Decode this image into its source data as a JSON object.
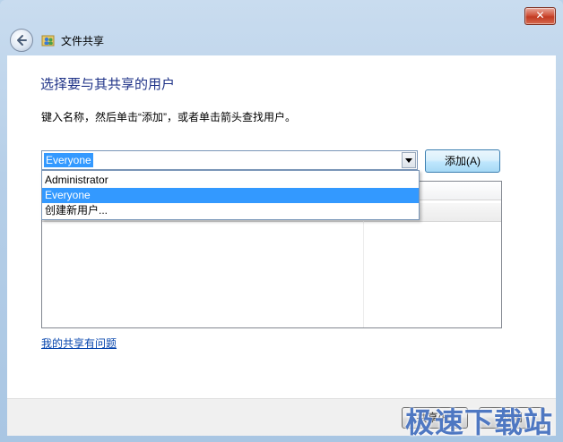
{
  "window": {
    "title": "文件共享",
    "close_label": "✕"
  },
  "main": {
    "heading": "选择要与其共享的用户",
    "instruction": "键入名称，然后单击“添加”，或者单击箭头查找用户。",
    "combo_value": "Everyone",
    "add_button": "添加(A)",
    "dropdown_options": [
      "Administrator",
      "Everyone",
      "创建新用户..."
    ],
    "dropdown_selected": "Everyone",
    "help_link": "我的共享有问题"
  },
  "footer": {
    "share_button": "共享(H)",
    "cancel_button": "取消"
  },
  "watermark": "极速下载站",
  "colors": {
    "heading": "#1e3287",
    "selection": "#3399ff",
    "link": "#0645ad"
  }
}
